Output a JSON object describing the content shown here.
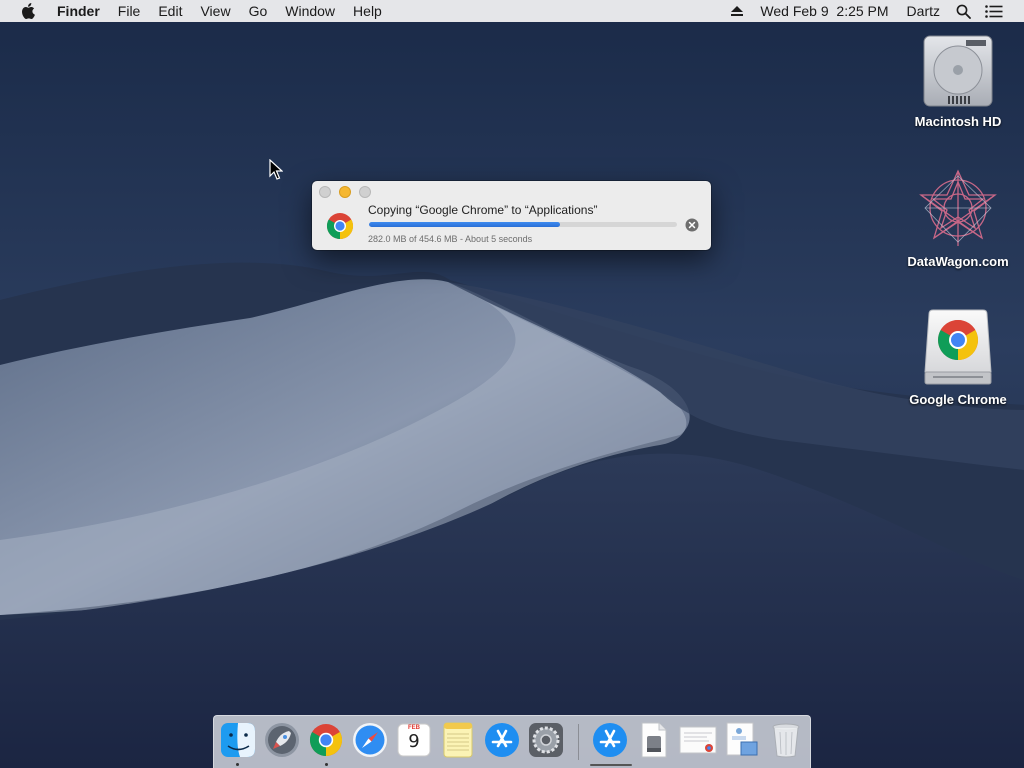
{
  "menubar": {
    "app_name": "Finder",
    "menus": [
      "File",
      "Edit",
      "View",
      "Go",
      "Window",
      "Help"
    ],
    "datetime": "Wed Feb 9  2:25 PM",
    "user": "Dartz",
    "icons": [
      "apple-icon",
      "eject-icon",
      "spotlight-search-icon",
      "notification-center-icon"
    ]
  },
  "desktop_icons": [
    {
      "label": "Macintosh HD",
      "icon": "hard-drive-icon"
    },
    {
      "label": "DataWagon.com",
      "icon": "datawagon-logo-icon"
    },
    {
      "label": "Google Chrome",
      "icon": "chrome-disk-image-icon"
    }
  ],
  "copy_dialog": {
    "title": "Copying “Google Chrome” to “Applications”",
    "status": "282.0 MB of 454.6 MB - About 5 seconds",
    "progress_fraction": 0.62,
    "icon": "chrome-icon",
    "progress_color": "#2f7be6"
  },
  "dock": {
    "items": [
      "finder",
      "launchpad",
      "google-chrome",
      "safari",
      "calendar",
      "notes",
      "app-store",
      "system-preferences",
      "app-store-downloads",
      "disk-image-file",
      "document",
      "preview-document",
      "trash"
    ],
    "calendar": {
      "month": "FEB",
      "day": "9"
    }
  }
}
